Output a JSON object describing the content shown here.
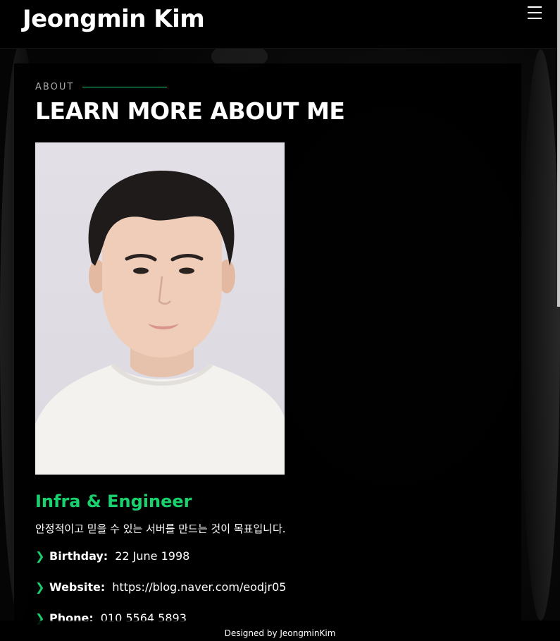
{
  "header": {
    "logo_text": "Jeongmin Kim",
    "menu_icon": "hamburger-menu-icon"
  },
  "about": {
    "section_label": "ABOUT",
    "title": "LEARN MORE ABOUT ME",
    "role_title": "Infra & Engineer",
    "description": "안정적이고 믿을 수 있는 서버를 만드는 것이 목표입니다.",
    "info": [
      {
        "label": "Birthday:",
        "value": "22 June 1998"
      },
      {
        "label": "Website:",
        "value": "https://blog.naver.com/eodjr05"
      },
      {
        "label": "Phone:",
        "value": "010 5564 5893"
      }
    ]
  },
  "footer": {
    "credit": "Designed by JeongminKim"
  },
  "colors": {
    "accent": "#18d26e",
    "background": "#000000",
    "text": "#ffffff",
    "muted": "#aaaaaa"
  }
}
